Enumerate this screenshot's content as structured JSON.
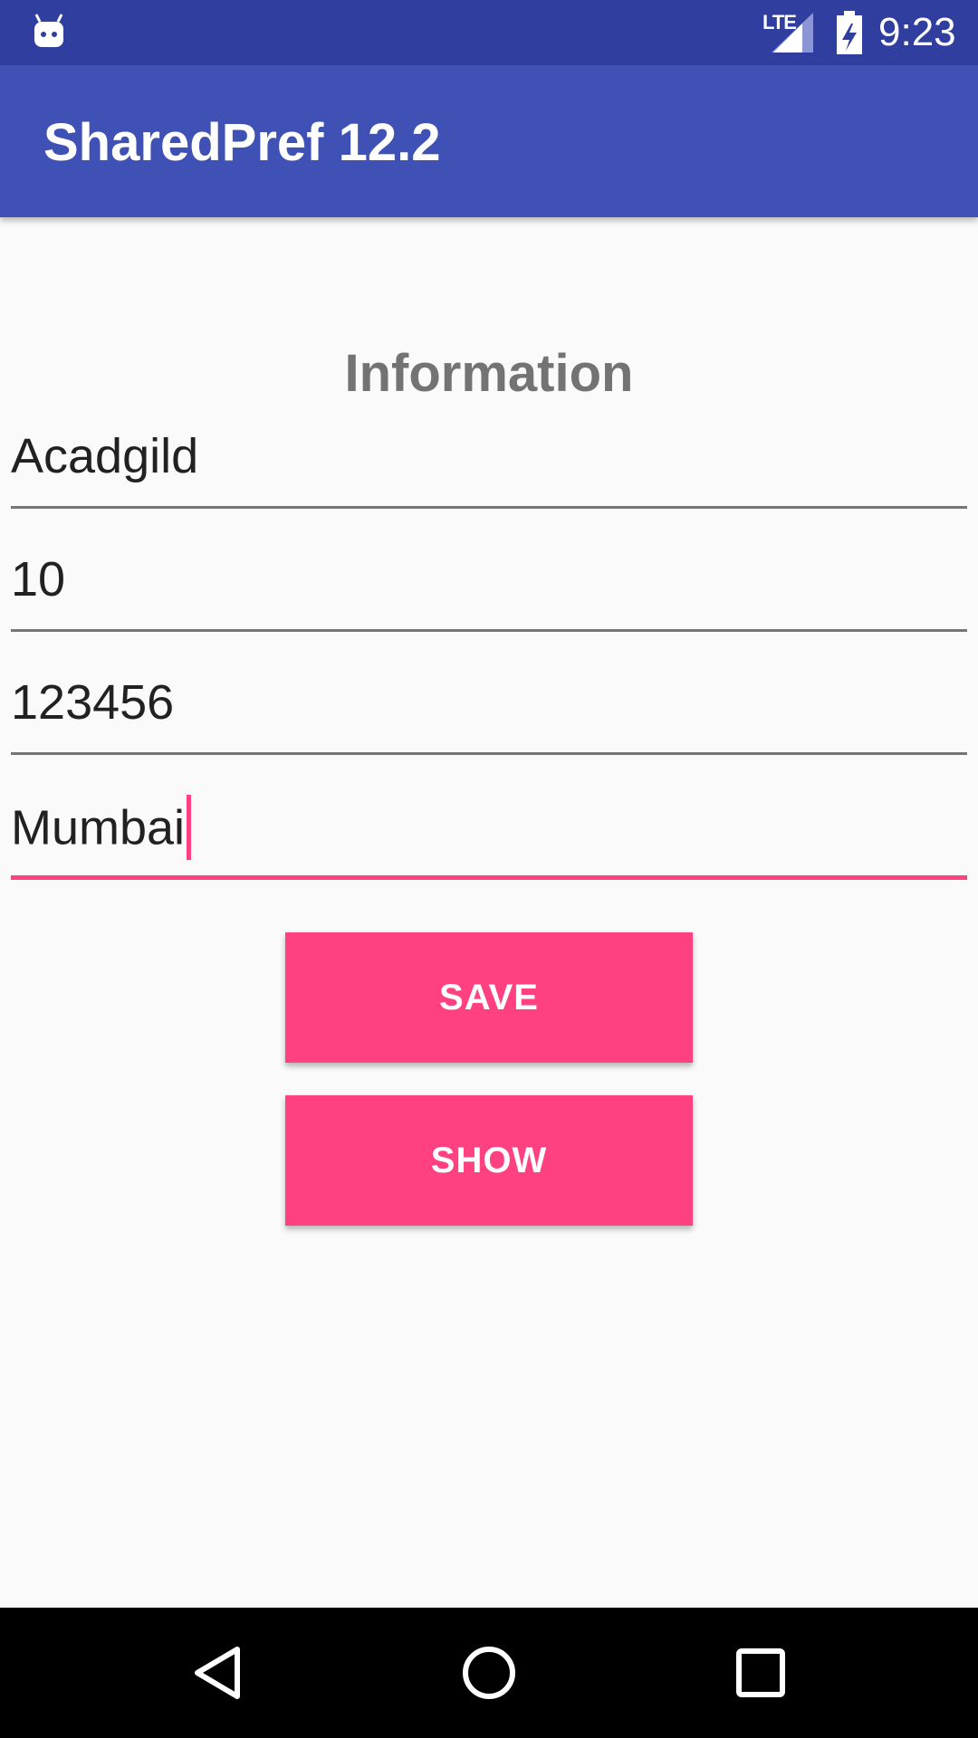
{
  "status_bar": {
    "network": "LTE",
    "time": "9:23",
    "colors": {
      "background": "#303f9f"
    },
    "icons": [
      "android-notification-icon",
      "signal-icon",
      "battery-icon"
    ]
  },
  "app_bar": {
    "title": "SharedPref 12.2",
    "colors": {
      "background": "#3f51b5",
      "text": "#ffffff"
    }
  },
  "content": {
    "heading": "Information",
    "fields": [
      {
        "value": "Acadgild",
        "focused": false
      },
      {
        "value": "10",
        "focused": false
      },
      {
        "value": "123456",
        "focused": false
      },
      {
        "value": "Mumbai",
        "focused": true
      }
    ],
    "buttons": {
      "save_label": "SAVE",
      "show_label": "SHOW"
    },
    "colors": {
      "accent": "#ff4081",
      "heading": "#737373"
    }
  },
  "nav_bar": {
    "icons": [
      "back-icon",
      "home-icon",
      "recents-icon"
    ]
  }
}
